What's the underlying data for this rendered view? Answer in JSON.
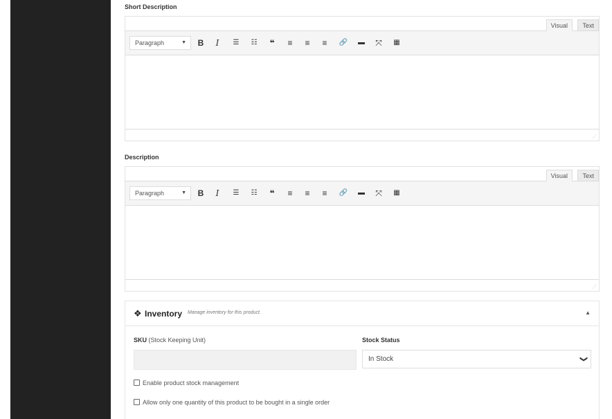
{
  "short_description": {
    "label": "Short Description",
    "tabs": {
      "visual": "Visual",
      "text": "Text"
    },
    "format_select": "Paragraph"
  },
  "description": {
    "label": "Description",
    "tabs": {
      "visual": "Visual",
      "text": "Text"
    },
    "format_select": "Paragraph"
  },
  "toolbar_glyphs": {
    "bold": "B",
    "italic": "I",
    "bullet_list": "☰",
    "numbered_list": "☷",
    "blockquote": "❝",
    "align_left": "≡",
    "align_center": "≡",
    "align_right": "≡",
    "link": "🔗",
    "read_more": "▬",
    "fullscreen": "⤧",
    "toolbar_toggle": "▦",
    "caret": "▼"
  },
  "inventory": {
    "title": "Inventory",
    "description": "Manage inventory for this product.",
    "icon": "cubes-icon",
    "sku_label_bold": "SKU",
    "sku_label_rest": " (Stock Keeping Unit)",
    "sku_value": "",
    "stock_status_label": "Stock Status",
    "stock_status_value": "In Stock",
    "manage_stock_label": "Enable product stock management",
    "sold_individually_label": "Allow only one quantity of this product to be bought in a single order"
  },
  "colors": {
    "sidebar": "#222222",
    "toolbar_bg": "#f5f5f5",
    "border": "#dcdcdc"
  }
}
